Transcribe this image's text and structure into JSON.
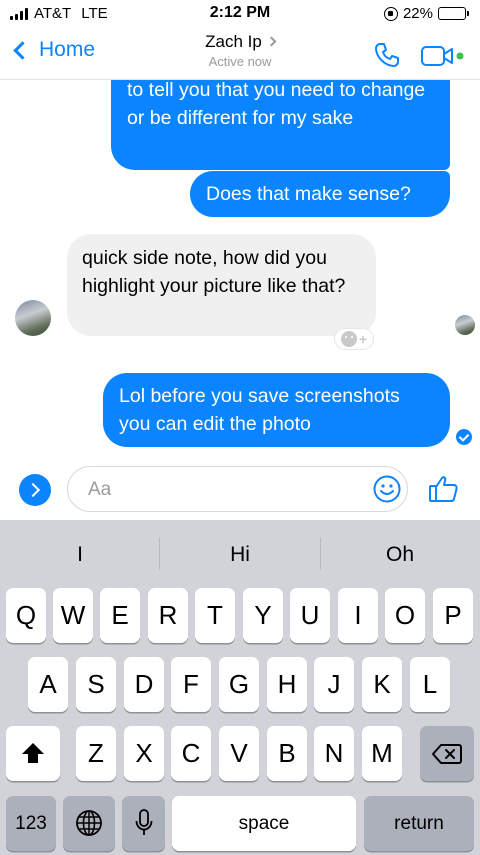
{
  "status_bar": {
    "carrier": "AT&T",
    "network": "LTE",
    "time": "2:12 PM",
    "battery": "22%",
    "battery_level": 0.22,
    "battery_color": "#f2c41f"
  },
  "nav": {
    "back_label": "Home",
    "contact_name": "Zach Ip",
    "contact_status": "Active now",
    "accent": "#0a84ff",
    "icons": [
      "phone-icon",
      "video-icon"
    ]
  },
  "messages": [
    {
      "from": "me",
      "text": "to tell you that you need to change or be different for my sake"
    },
    {
      "from": "me",
      "text": "Does that make sense?"
    },
    {
      "from": "contact",
      "text": "quick side note, how did you highlight your picture like that?"
    },
    {
      "from": "me",
      "text": "Lol before you save screenshots you can edit the photo"
    }
  ],
  "composer": {
    "placeholder": "Aa"
  },
  "keyboard": {
    "suggestions": [
      "I",
      "Hi",
      "Oh"
    ],
    "row1": [
      "Q",
      "W",
      "E",
      "R",
      "T",
      "Y",
      "U",
      "I",
      "O",
      "P"
    ],
    "row2": [
      "A",
      "S",
      "D",
      "F",
      "G",
      "H",
      "J",
      "K",
      "L"
    ],
    "row3": [
      "Z",
      "X",
      "C",
      "V",
      "B",
      "N",
      "M"
    ],
    "numbers_label": "123",
    "space_label": "space",
    "return_label": "return"
  }
}
